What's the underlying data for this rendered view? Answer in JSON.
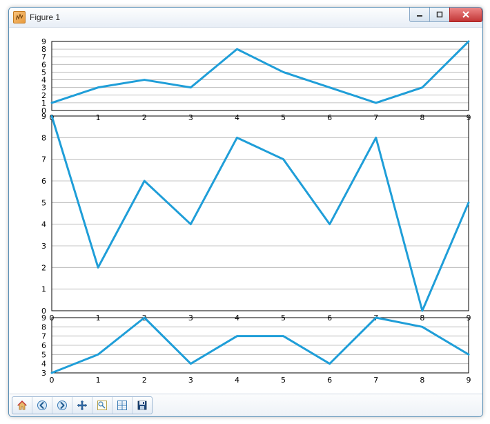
{
  "window": {
    "title": "Figure 1"
  },
  "toolbar": {
    "buttons": [
      "home",
      "back",
      "forward",
      "pan",
      "zoom",
      "subplots",
      "save"
    ]
  },
  "chart_data": [
    {
      "type": "line",
      "subplot": "top",
      "x": [
        0,
        1,
        2,
        3,
        4,
        5,
        6,
        7,
        8,
        9
      ],
      "y": [
        1,
        3,
        4,
        3,
        8,
        5,
        3,
        1,
        3,
        9
      ],
      "xticks": [
        0,
        1,
        2,
        3,
        4,
        5,
        6,
        7,
        8,
        9
      ],
      "yticks": [
        0,
        1,
        2,
        3,
        4,
        5,
        6,
        7,
        8,
        9
      ],
      "xlim": [
        0,
        9
      ],
      "ylim": [
        0,
        9
      ],
      "grid": true,
      "color": "#1f9ed8"
    },
    {
      "type": "line",
      "subplot": "middle",
      "x": [
        0,
        1,
        2,
        3,
        4,
        5,
        6,
        7,
        8,
        9
      ],
      "y": [
        9,
        2,
        6,
        4,
        8,
        7,
        4,
        8,
        0,
        5
      ],
      "xticks": [
        0,
        1,
        2,
        3,
        4,
        5,
        6,
        7,
        8,
        9
      ],
      "yticks": [
        0,
        1,
        2,
        3,
        4,
        5,
        6,
        7,
        8,
        9
      ],
      "xlim": [
        0,
        9
      ],
      "ylim": [
        0,
        9
      ],
      "grid": true,
      "color": "#1f9ed8"
    },
    {
      "type": "line",
      "subplot": "bottom",
      "x": [
        0,
        1,
        2,
        3,
        4,
        5,
        6,
        7,
        8,
        9
      ],
      "y": [
        3,
        5,
        9,
        4,
        7,
        7,
        4,
        9,
        8,
        5
      ],
      "xticks": [
        0,
        1,
        2,
        3,
        4,
        5,
        6,
        7,
        8,
        9
      ],
      "yticks": [
        3,
        4,
        5,
        6,
        7,
        8,
        9
      ],
      "xlim": [
        0,
        9
      ],
      "ylim": [
        3,
        9
      ],
      "grid": true,
      "color": "#1f9ed8"
    }
  ]
}
